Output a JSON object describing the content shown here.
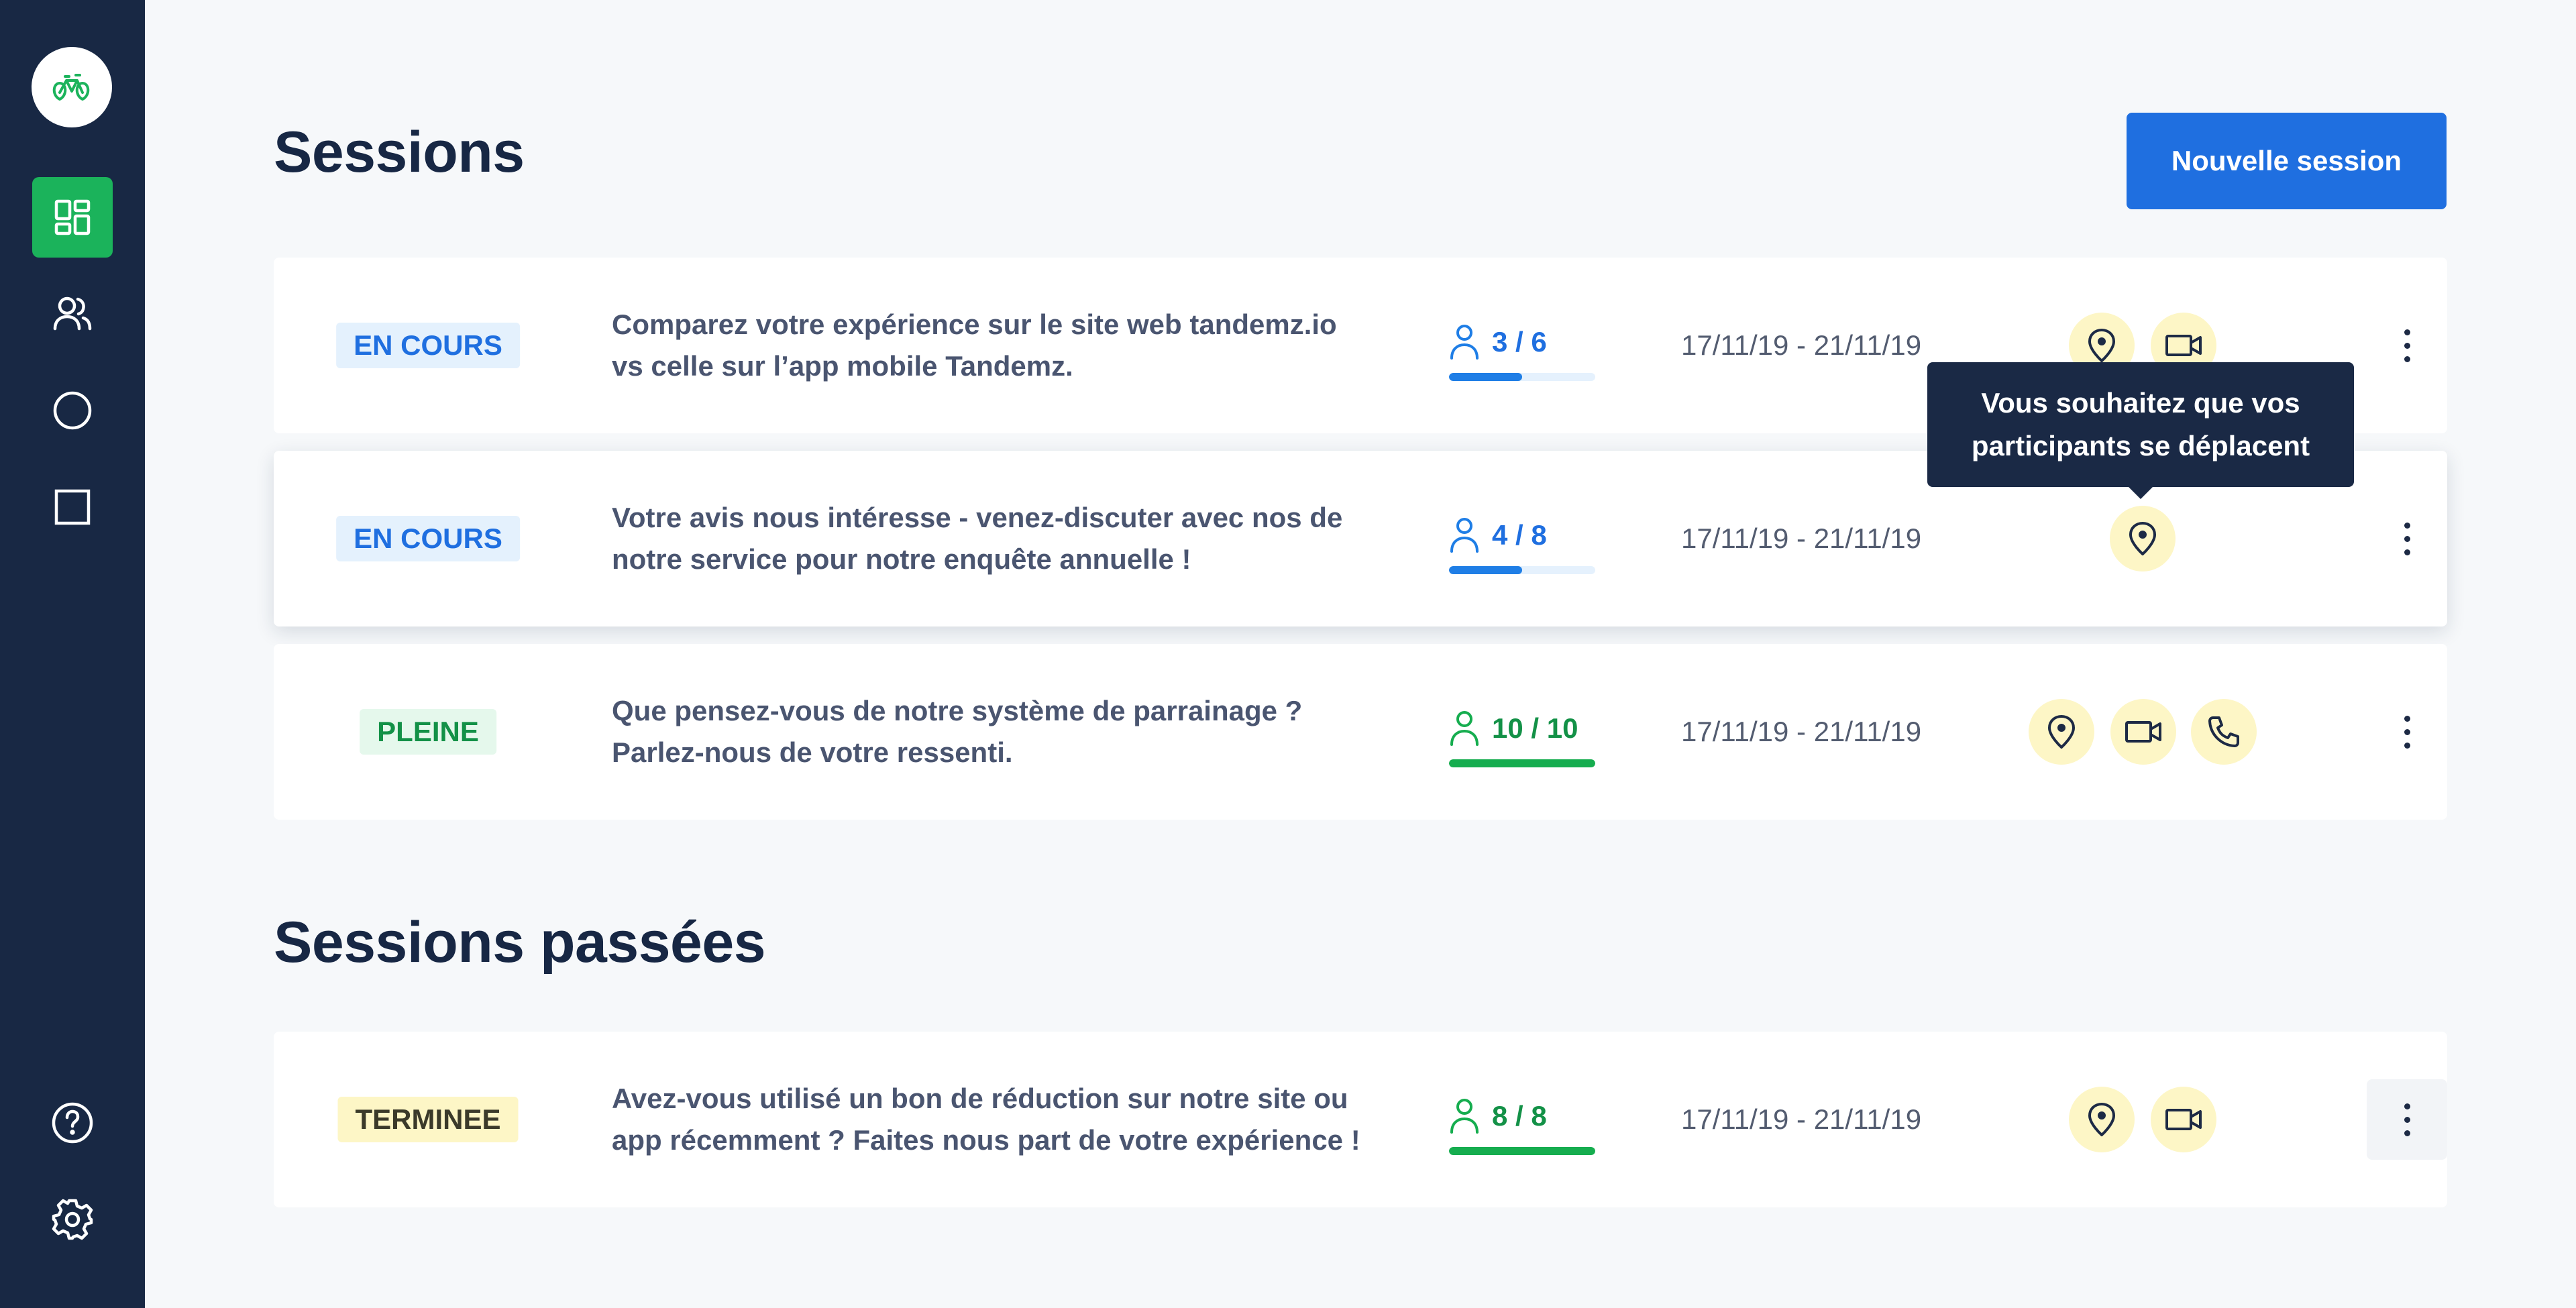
{
  "sidebar": {
    "logo": "tandem-bike-logo",
    "nav": [
      {
        "name": "dashboard",
        "icon": "grid-icon",
        "active": true
      },
      {
        "name": "users",
        "icon": "users-icon",
        "active": false
      },
      {
        "name": "circle",
        "icon": "circle-icon",
        "active": false
      },
      {
        "name": "square",
        "icon": "square-icon",
        "active": false
      }
    ],
    "bottom": [
      {
        "name": "help",
        "icon": "help-icon"
      },
      {
        "name": "settings",
        "icon": "gear-icon"
      }
    ]
  },
  "main": {
    "title": "Sessions",
    "new_session_label": "Nouvelle session",
    "past_title": "Sessions passées",
    "tooltip": {
      "line1": "Vous souhaitez que vos",
      "line2": "participants se déplacent"
    }
  },
  "sessions": [
    {
      "status": "EN COURS",
      "status_color": "#1f6fe0",
      "line1": "Comparez votre expérience sur le site web tandemz.io",
      "line2": "vs celle sur l’app mobile Tandemz.",
      "count": "3 / 6",
      "filled": 3,
      "total": 6,
      "dates": "17/11/19 - 21/11/19",
      "modes": [
        "location-pin-icon",
        "video-camera-icon"
      ]
    },
    {
      "status": "EN COURS",
      "status_color": "#1f6fe0",
      "line1": "Votre avis nous intéresse - venez-discuter avec nos de",
      "line2": "notre service pour notre enquête annuelle !",
      "count": "4 / 8",
      "filled": 4,
      "total": 8,
      "dates": "17/11/19 - 21/11/19",
      "modes": [
        "location-pin-icon"
      ]
    },
    {
      "status": "PLEINE",
      "status_color": "#139147",
      "line1": "Que pensez-vous de notre système de parrainage ?",
      "line2": "Parlez-nous de votre ressenti.",
      "count": "10 / 10",
      "filled": 10,
      "total": 10,
      "dates": "17/11/19 - 21/11/19",
      "modes": [
        "location-pin-icon",
        "video-camera-icon",
        "phone-icon"
      ]
    }
  ],
  "past_sessions": [
    {
      "status": "TERMINEE",
      "status_color": "#3b3a2a",
      "line1": "Avez-vous utilisé un bon de réduction sur notre site ou",
      "line2": "app récemment ? Faites nous part de votre expérience !",
      "count": "8 / 8",
      "filled": 8,
      "total": 8,
      "dates": "17/11/19 - 21/11/19",
      "modes": [
        "location-pin-icon",
        "video-camera-icon"
      ]
    }
  ],
  "colors": {
    "sidebar": "#182844",
    "accent_green": "#1bb35b",
    "primary_blue": "#1f6fe0",
    "mode_bg": "#fdf6c6"
  }
}
